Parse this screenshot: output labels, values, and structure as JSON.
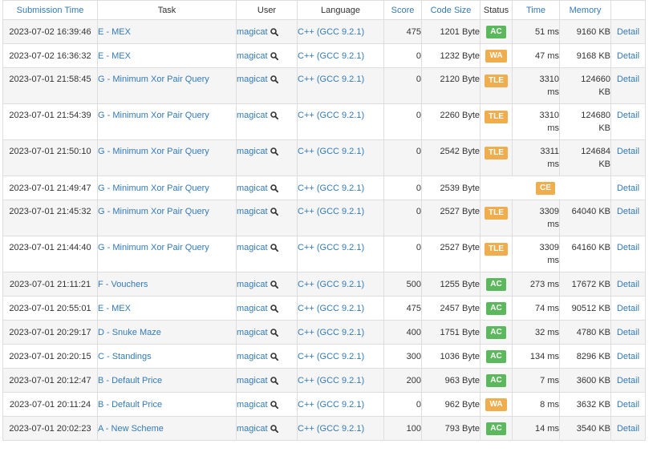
{
  "headers": {
    "submission_time": "Submission Time",
    "task": "Task",
    "user": "User",
    "language": "Language",
    "score": "Score",
    "code_size": "Code Size",
    "status": "Status",
    "time": "Time",
    "memory": "Memory",
    "detail": ""
  },
  "colors": {
    "link": "#337ab7",
    "ac": "#5cb85c",
    "warning": "#f0ad4e"
  },
  "icons": {
    "user_search": "search-icon"
  },
  "rows": [
    {
      "time": "2023-07-02 16:39:46",
      "task": "E - MEX",
      "user": "magicat",
      "language": "C++ (GCC 9.2.1)",
      "score": "475",
      "size": "1201 Byte",
      "status": "AC",
      "exec1": "51 ms",
      "exec2": "",
      "mem1": "9160 KB",
      "mem2": "",
      "detail": "Detail"
    },
    {
      "time": "2023-07-02 16:36:32",
      "task": "E - MEX",
      "user": "magicat",
      "language": "C++ (GCC 9.2.1)",
      "score": "0",
      "size": "1232 Byte",
      "status": "WA",
      "exec1": "47 ms",
      "exec2": "",
      "mem1": "9168 KB",
      "mem2": "",
      "detail": "Detail"
    },
    {
      "time": "2023-07-01 21:58:45",
      "task": "G - Minimum Xor Pair Query",
      "user": "magicat",
      "language": "C++ (GCC 9.2.1)",
      "score": "0",
      "size": "2120 Byte",
      "status": "TLE",
      "exec1": "3310",
      "exec2": "ms",
      "mem1": "124660",
      "mem2": "KB",
      "detail": "Detail"
    },
    {
      "time": "2023-07-01 21:54:39",
      "task": "G - Minimum Xor Pair Query",
      "user": "magicat",
      "language": "C++ (GCC 9.2.1)",
      "score": "0",
      "size": "2260 Byte",
      "status": "TLE",
      "exec1": "3310",
      "exec2": "ms",
      "mem1": "124680",
      "mem2": "KB",
      "detail": "Detail"
    },
    {
      "time": "2023-07-01 21:50:10",
      "task": "G - Minimum Xor Pair Query",
      "user": "magicat",
      "language": "C++ (GCC 9.2.1)",
      "score": "0",
      "size": "2542 Byte",
      "status": "TLE",
      "exec1": "3311",
      "exec2": "ms",
      "mem1": "124684",
      "mem2": "KB",
      "detail": "Detail"
    },
    {
      "time": "2023-07-01 21:49:47",
      "task": "G - Minimum Xor Pair Query",
      "user": "magicat",
      "language": "C++ (GCC 9.2.1)",
      "score": "0",
      "size": "2539 Byte",
      "status": "CE",
      "exec1": "",
      "exec2": "",
      "mem1": "",
      "mem2": "",
      "detail": "Detail"
    },
    {
      "time": "2023-07-01 21:45:32",
      "task": "G - Minimum Xor Pair Query",
      "user": "magicat",
      "language": "C++ (GCC 9.2.1)",
      "score": "0",
      "size": "2527 Byte",
      "status": "TLE",
      "exec1": "3309",
      "exec2": "ms",
      "mem1": "64040 KB",
      "mem2": "",
      "detail": "Detail"
    },
    {
      "time": "2023-07-01 21:44:40",
      "task": "G - Minimum Xor Pair Query",
      "user": "magicat",
      "language": "C++ (GCC 9.2.1)",
      "score": "0",
      "size": "2527 Byte",
      "status": "TLE",
      "exec1": "3309",
      "exec2": "ms",
      "mem1": "64160 KB",
      "mem2": "",
      "detail": "Detail"
    },
    {
      "time": "2023-07-01 21:11:21",
      "task": "F - Vouchers",
      "user": "magicat",
      "language": "C++ (GCC 9.2.1)",
      "score": "500",
      "size": "1255 Byte",
      "status": "AC",
      "exec1": "273 ms",
      "exec2": "",
      "mem1": "17672 KB",
      "mem2": "",
      "detail": "Detail"
    },
    {
      "time": "2023-07-01 20:55:01",
      "task": "E - MEX",
      "user": "magicat",
      "language": "C++ (GCC 9.2.1)",
      "score": "475",
      "size": "2457 Byte",
      "status": "AC",
      "exec1": "74 ms",
      "exec2": "",
      "mem1": "90512 KB",
      "mem2": "",
      "detail": "Detail"
    },
    {
      "time": "2023-07-01 20:29:17",
      "task": "D - Snuke Maze",
      "user": "magicat",
      "language": "C++ (GCC 9.2.1)",
      "score": "400",
      "size": "1751 Byte",
      "status": "AC",
      "exec1": "32 ms",
      "exec2": "",
      "mem1": "4780 KB",
      "mem2": "",
      "detail": "Detail"
    },
    {
      "time": "2023-07-01 20:20:15",
      "task": "C - Standings",
      "user": "magicat",
      "language": "C++ (GCC 9.2.1)",
      "score": "300",
      "size": "1036 Byte",
      "status": "AC",
      "exec1": "134 ms",
      "exec2": "",
      "mem1": "8296 KB",
      "mem2": "",
      "detail": "Detail"
    },
    {
      "time": "2023-07-01 20:12:47",
      "task": "B - Default Price",
      "user": "magicat",
      "language": "C++ (GCC 9.2.1)",
      "score": "200",
      "size": "963 Byte",
      "status": "AC",
      "exec1": "7 ms",
      "exec2": "",
      "mem1": "3600 KB",
      "mem2": "",
      "detail": "Detail"
    },
    {
      "time": "2023-07-01 20:11:24",
      "task": "B - Default Price",
      "user": "magicat",
      "language": "C++ (GCC 9.2.1)",
      "score": "0",
      "size": "962 Byte",
      "status": "WA",
      "exec1": "8 ms",
      "exec2": "",
      "mem1": "3632 KB",
      "mem2": "",
      "detail": "Detail"
    },
    {
      "time": "2023-07-01 20:02:23",
      "task": "A - New Scheme",
      "user": "magicat",
      "language": "C++ (GCC 9.2.1)",
      "score": "100",
      "size": "793 Byte",
      "status": "AC",
      "exec1": "14 ms",
      "exec2": "",
      "mem1": "3540 KB",
      "mem2": "",
      "detail": "Detail"
    }
  ]
}
